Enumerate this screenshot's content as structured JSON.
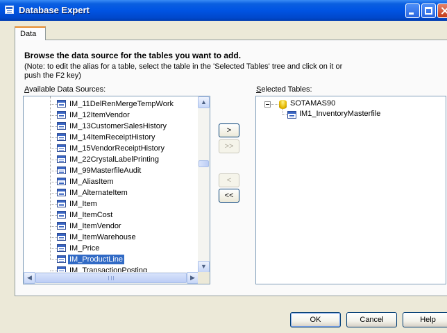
{
  "window": {
    "title": "Database Expert",
    "colors": {
      "title_bar": "#0054e3",
      "selection": "#316ac5",
      "dialog_bg": "#ece9d8"
    }
  },
  "tabs": [
    {
      "label": "Data"
    }
  ],
  "content": {
    "heading": "Browse the data source for the tables you want to add.",
    "note_line1": "(Note: to edit the alias for a table, select the table in the 'Selected Tables' tree and click on it or",
    "note_line2": "push the F2 key)",
    "available_label_first": "A",
    "available_label_rest": "vailable Data Sources:",
    "selected_label_first": "S",
    "selected_label_rest": "elected Tables:"
  },
  "available_tables": [
    "IM_11DelRenMergeTempWork",
    "IM_12ItemVendor",
    "IM_13CustomerSalesHistory",
    "IM_14ItemReceiptHistory",
    "IM_15VendorReceiptHistory",
    "IM_22CrystalLabelPrinting",
    "IM_99MasterfileAudit",
    "IM_AliasItem",
    "IM_AlternateItem",
    "IM_Item",
    "IM_ItemCost",
    "IM_ItemVendor",
    "IM_ItemWarehouse",
    "IM_Price",
    "IM_ProductLine",
    "IM_TransactionPosting"
  ],
  "selected_index": 14,
  "selected_tree": {
    "datasource": "SOTAMAS90",
    "tables": [
      "IM1_InventoryMasterfile"
    ]
  },
  "transfer_buttons": {
    "add": ">",
    "add_all": ">>",
    "remove": "<",
    "remove_all": "<<"
  },
  "footer": {
    "ok": "OK",
    "cancel": "Cancel",
    "help": "Help"
  },
  "icons": {
    "app": "database-expert-icon",
    "table": "table-icon",
    "datasource": "database-icon",
    "collapse": "tree-collapse-icon"
  }
}
